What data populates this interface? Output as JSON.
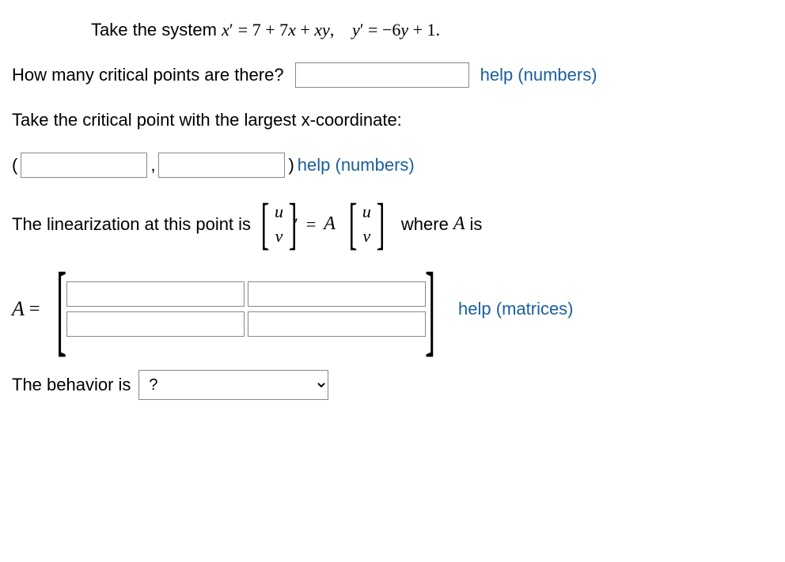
{
  "q1": {
    "prefix": "Take the system ",
    "eq": "x′ = 7 + 7x + xy,   y′ = −6y + 1."
  },
  "q2": {
    "text": "How many critical points are there?",
    "help": "help (numbers)"
  },
  "q3": {
    "text": "Take the critical point with the largest x-coordinate:"
  },
  "q4": {
    "open": "( ",
    "comma": " , ",
    "close": " ) ",
    "help": "help (numbers)"
  },
  "q5": {
    "prefix": "The linearization at this point is ",
    "u": "u",
    "v": "v",
    "eq": " = ",
    "A": "A",
    "suffix": " where ",
    "Ais": " is"
  },
  "q6": {
    "Aeq": "A = ",
    "help": "help (matrices)"
  },
  "q7": {
    "text": "The behavior is ",
    "placeholder": "?"
  }
}
